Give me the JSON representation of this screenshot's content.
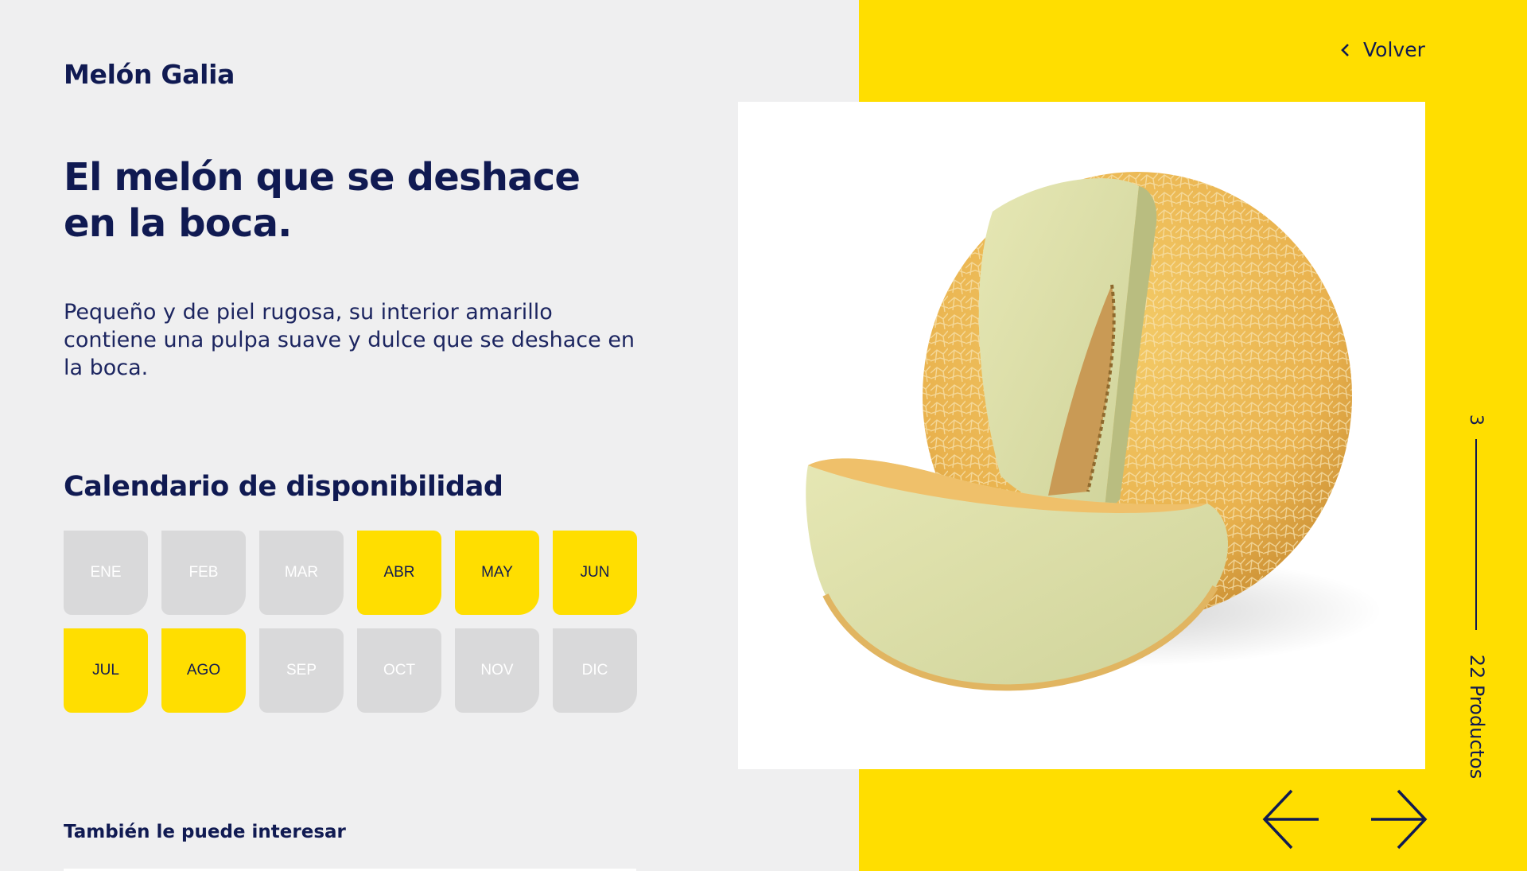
{
  "product": {
    "name": "Melón Galia",
    "headline": "El melón que se deshace en la boca.",
    "description": "Pequeño y de piel rugosa, su interior amarillo contiene una pulpa suave y dulce que se deshace en la boca."
  },
  "calendar": {
    "title": "Calendario de disponibilidad",
    "months": [
      {
        "label": "ENE",
        "available": false
      },
      {
        "label": "FEB",
        "available": false
      },
      {
        "label": "MAR",
        "available": false
      },
      {
        "label": "ABR",
        "available": true
      },
      {
        "label": "MAY",
        "available": true
      },
      {
        "label": "JUN",
        "available": true
      },
      {
        "label": "JUL",
        "available": true
      },
      {
        "label": "AGO",
        "available": true
      },
      {
        "label": "SEP",
        "available": false
      },
      {
        "label": "OCT",
        "available": false
      },
      {
        "label": "NOV",
        "available": false
      },
      {
        "label": "DIC",
        "available": false
      }
    ]
  },
  "related": {
    "title": "También le puede interesar"
  },
  "nav": {
    "back_label": "Volver",
    "back_icon": "chevron-left-icon",
    "prev_icon": "arrow-left-icon",
    "next_icon": "arrow-right-icon"
  },
  "pager": {
    "current": "3",
    "total": "22 Productos"
  },
  "colors": {
    "accent": "#ffde00",
    "text": "#101a52",
    "background": "#efeff0",
    "month_unavailable": "#d9d9da"
  }
}
